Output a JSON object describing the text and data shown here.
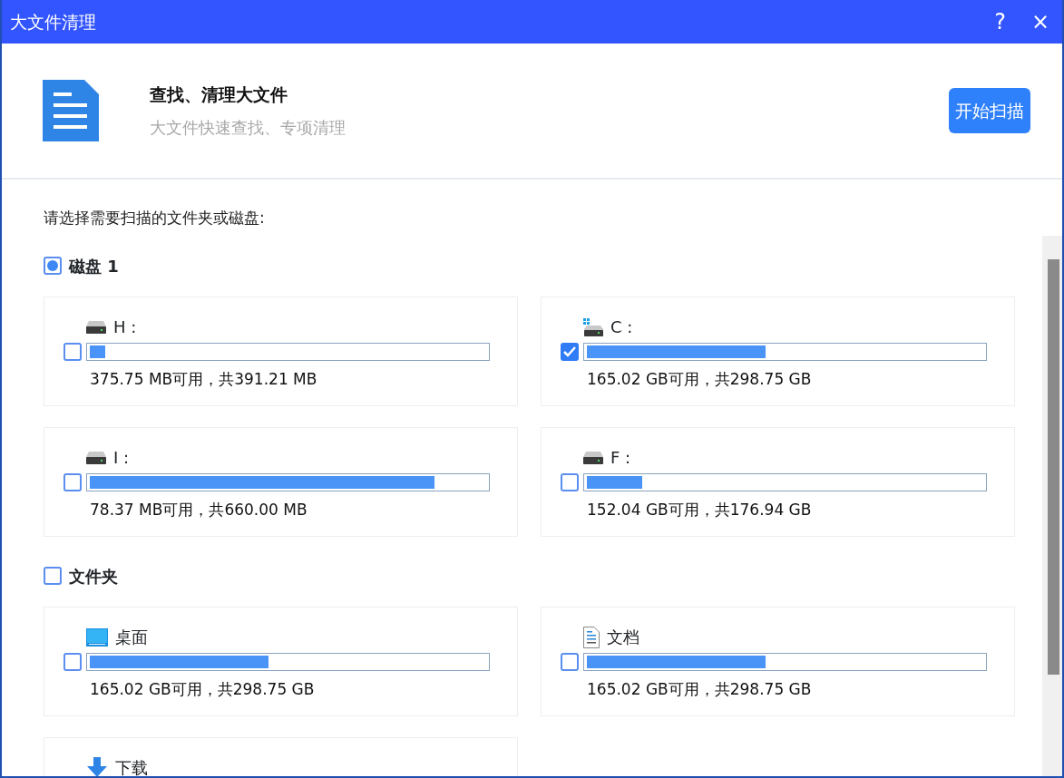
{
  "window": {
    "title": "大文件清理",
    "help": "?",
    "close": "×"
  },
  "header": {
    "title": "查找、清理大文件",
    "subtitle": "大文件快速查找、专项清理",
    "scan_button": "开始扫描"
  },
  "prompt": "请选择需要扫描的文件夹或磁盘:",
  "groups": [
    {
      "label": "磁盘 1",
      "checked": false,
      "partial": true,
      "items": [
        {
          "kind": "drive",
          "label": "H :",
          "checked": false,
          "level": 0.04,
          "size": "375.75 MB可用，共391.21 MB"
        },
        {
          "kind": "system-drive",
          "label": "C :",
          "checked": true,
          "level": 0.45,
          "size": "165.02 GB可用，共298.75 GB"
        },
        {
          "kind": "drive",
          "label": "I :",
          "checked": false,
          "level": 0.87,
          "size": "78.37 MB可用，共660.00 MB"
        },
        {
          "kind": "drive",
          "label": "F :",
          "checked": false,
          "level": 0.14,
          "size": "152.04 GB可用，共176.94 GB"
        }
      ]
    },
    {
      "label": "文件夹",
      "checked": false,
      "partial": false,
      "items": [
        {
          "kind": "desktop",
          "label": "桌面",
          "checked": false,
          "level": 0.45,
          "size": "165.02 GB可用，共298.75 GB"
        },
        {
          "kind": "document",
          "label": "文档",
          "checked": false,
          "level": 0.45,
          "size": "165.02 GB可用，共298.75 GB"
        },
        {
          "kind": "download",
          "label": "下载"
        }
      ]
    }
  ]
}
